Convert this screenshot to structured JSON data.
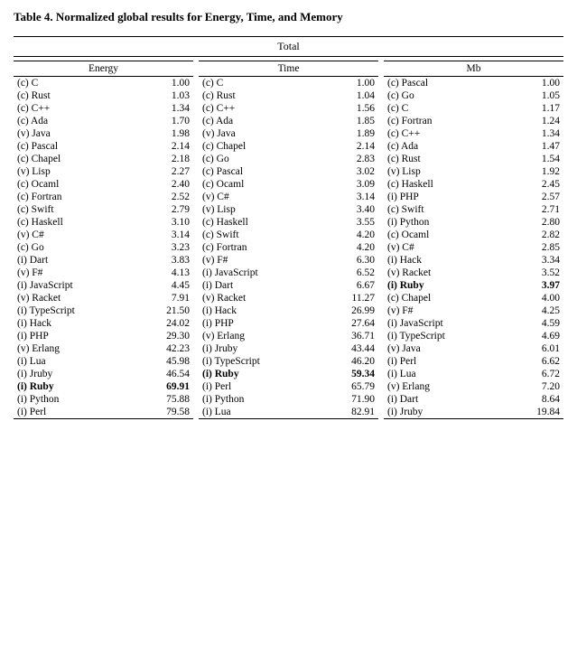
{
  "title": "Table 4. Normalized global results for Energy, Time, and Memory",
  "total_label": "Total",
  "energy_col": "Energy",
  "time_col": "Time",
  "mb_col": "Mb",
  "energy_rows": [
    {
      "lang": "(c) C",
      "val": "1.00",
      "bold": false
    },
    {
      "lang": "(c) Rust",
      "val": "1.03",
      "bold": false
    },
    {
      "lang": "(c) C++",
      "val": "1.34",
      "bold": false
    },
    {
      "lang": "(c) Ada",
      "val": "1.70",
      "bold": false
    },
    {
      "lang": "(v) Java",
      "val": "1.98",
      "bold": false
    },
    {
      "lang": "(c) Pascal",
      "val": "2.14",
      "bold": false
    },
    {
      "lang": "(c) Chapel",
      "val": "2.18",
      "bold": false
    },
    {
      "lang": "(v) Lisp",
      "val": "2.27",
      "bold": false
    },
    {
      "lang": "(c) Ocaml",
      "val": "2.40",
      "bold": false
    },
    {
      "lang": "(c) Fortran",
      "val": "2.52",
      "bold": false
    },
    {
      "lang": "(c) Swift",
      "val": "2.79",
      "bold": false
    },
    {
      "lang": "(c) Haskell",
      "val": "3.10",
      "bold": false
    },
    {
      "lang": "(v) C#",
      "val": "3.14",
      "bold": false
    },
    {
      "lang": "(c) Go",
      "val": "3.23",
      "bold": false
    },
    {
      "lang": "(i) Dart",
      "val": "3.83",
      "bold": false
    },
    {
      "lang": "(v) F#",
      "val": "4.13",
      "bold": false
    },
    {
      "lang": "(i) JavaScript",
      "val": "4.45",
      "bold": false
    },
    {
      "lang": "(v) Racket",
      "val": "7.91",
      "bold": false
    },
    {
      "lang": "(i) TypeScript",
      "val": "21.50",
      "bold": false
    },
    {
      "lang": "(i) Hack",
      "val": "24.02",
      "bold": false
    },
    {
      "lang": "(i) PHP",
      "val": "29.30",
      "bold": false
    },
    {
      "lang": "(v) Erlang",
      "val": "42.23",
      "bold": false
    },
    {
      "lang": "(i) Lua",
      "val": "45.98",
      "bold": false
    },
    {
      "lang": "(i) Jruby",
      "val": "46.54",
      "bold": false
    },
    {
      "lang": "(i) Ruby",
      "val": "69.91",
      "bold": true
    },
    {
      "lang": "(i) Python",
      "val": "75.88",
      "bold": false
    },
    {
      "lang": "(i) Perl",
      "val": "79.58",
      "bold": false
    }
  ],
  "time_rows": [
    {
      "lang": "(c) C",
      "val": "1.00",
      "bold": false
    },
    {
      "lang": "(c) Rust",
      "val": "1.04",
      "bold": false
    },
    {
      "lang": "(c) C++",
      "val": "1.56",
      "bold": false
    },
    {
      "lang": "(c) Ada",
      "val": "1.85",
      "bold": false
    },
    {
      "lang": "(v) Java",
      "val": "1.89",
      "bold": false
    },
    {
      "lang": "(c) Chapel",
      "val": "2.14",
      "bold": false
    },
    {
      "lang": "(c) Go",
      "val": "2.83",
      "bold": false
    },
    {
      "lang": "(c) Pascal",
      "val": "3.02",
      "bold": false
    },
    {
      "lang": "(c) Ocaml",
      "val": "3.09",
      "bold": false
    },
    {
      "lang": "(v) C#",
      "val": "3.14",
      "bold": false
    },
    {
      "lang": "(v) Lisp",
      "val": "3.40",
      "bold": false
    },
    {
      "lang": "(c) Haskell",
      "val": "3.55",
      "bold": false
    },
    {
      "lang": "(c) Swift",
      "val": "4.20",
      "bold": false
    },
    {
      "lang": "(c) Fortran",
      "val": "4.20",
      "bold": false
    },
    {
      "lang": "(v) F#",
      "val": "6.30",
      "bold": false
    },
    {
      "lang": "(i) JavaScript",
      "val": "6.52",
      "bold": false
    },
    {
      "lang": "(i) Dart",
      "val": "6.67",
      "bold": false
    },
    {
      "lang": "(v) Racket",
      "val": "11.27",
      "bold": false
    },
    {
      "lang": "(i) Hack",
      "val": "26.99",
      "bold": false
    },
    {
      "lang": "(i) PHP",
      "val": "27.64",
      "bold": false
    },
    {
      "lang": "(v) Erlang",
      "val": "36.71",
      "bold": false
    },
    {
      "lang": "(i) Jruby",
      "val": "43.44",
      "bold": false
    },
    {
      "lang": "(i) TypeScript",
      "val": "46.20",
      "bold": false
    },
    {
      "lang": "(i) Ruby",
      "val": "59.34",
      "bold": true
    },
    {
      "lang": "(i) Perl",
      "val": "65.79",
      "bold": false
    },
    {
      "lang": "(i) Python",
      "val": "71.90",
      "bold": false
    },
    {
      "lang": "(i) Lua",
      "val": "82.91",
      "bold": false
    }
  ],
  "mb_rows": [
    {
      "lang": "(c) Pascal",
      "val": "1.00",
      "bold": false
    },
    {
      "lang": "(c) Go",
      "val": "1.05",
      "bold": false
    },
    {
      "lang": "(c) C",
      "val": "1.17",
      "bold": false
    },
    {
      "lang": "(c) Fortran",
      "val": "1.24",
      "bold": false
    },
    {
      "lang": "(c) C++",
      "val": "1.34",
      "bold": false
    },
    {
      "lang": "(c) Ada",
      "val": "1.47",
      "bold": false
    },
    {
      "lang": "(c) Rust",
      "val": "1.54",
      "bold": false
    },
    {
      "lang": "(v) Lisp",
      "val": "1.92",
      "bold": false
    },
    {
      "lang": "(c) Haskell",
      "val": "2.45",
      "bold": false
    },
    {
      "lang": "(i) PHP",
      "val": "2.57",
      "bold": false
    },
    {
      "lang": "(c) Swift",
      "val": "2.71",
      "bold": false
    },
    {
      "lang": "(i) Python",
      "val": "2.80",
      "bold": false
    },
    {
      "lang": "(c) Ocaml",
      "val": "2.82",
      "bold": false
    },
    {
      "lang": "(v) C#",
      "val": "2.85",
      "bold": false
    },
    {
      "lang": "(i) Hack",
      "val": "3.34",
      "bold": false
    },
    {
      "lang": "(v) Racket",
      "val": "3.52",
      "bold": false
    },
    {
      "lang": "(i) Ruby",
      "val": "3.97",
      "bold": true
    },
    {
      "lang": "(c) Chapel",
      "val": "4.00",
      "bold": false
    },
    {
      "lang": "(v) F#",
      "val": "4.25",
      "bold": false
    },
    {
      "lang": "(i) JavaScript",
      "val": "4.59",
      "bold": false
    },
    {
      "lang": "(i) TypeScript",
      "val": "4.69",
      "bold": false
    },
    {
      "lang": "(v) Java",
      "val": "6.01",
      "bold": false
    },
    {
      "lang": "(i) Perl",
      "val": "6.62",
      "bold": false
    },
    {
      "lang": "(i) Lua",
      "val": "6.72",
      "bold": false
    },
    {
      "lang": "(v) Erlang",
      "val": "7.20",
      "bold": false
    },
    {
      "lang": "(i) Dart",
      "val": "8.64",
      "bold": false
    },
    {
      "lang": "(i) Jruby",
      "val": "19.84",
      "bold": false
    }
  ]
}
